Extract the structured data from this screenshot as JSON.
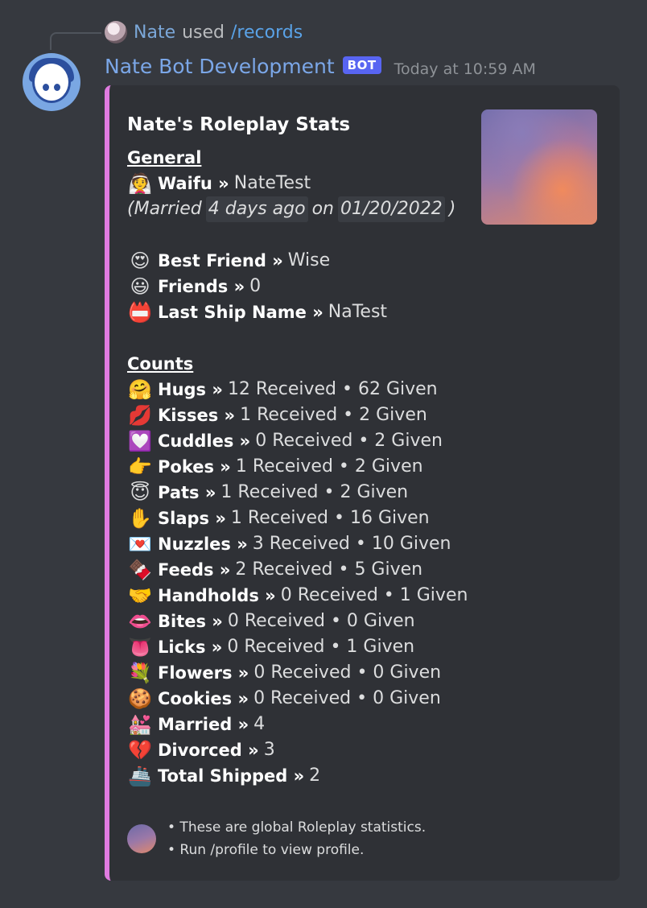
{
  "reply": {
    "user": "Nate",
    "verb": "used",
    "command": "/records"
  },
  "message": {
    "author": "Nate Bot Development",
    "tag": "BOT",
    "timestamp": "Today at 10:59 AM"
  },
  "embed": {
    "title": "Nate's Roleplay Stats",
    "accent_color": "#e07be0",
    "general": {
      "heading": "General",
      "waifu": {
        "icon": "👰",
        "icon_name": "bride-icon",
        "label": "Waifu »",
        "value": "NateTest"
      },
      "married": {
        "prefix": "(Married",
        "ago": "4 days ago",
        "on": "on",
        "date": "01/20/2022",
        "suffix": ")"
      },
      "best_friend": {
        "icon": "😍",
        "icon_name": "heart-eyes-icon",
        "label": "Best Friend »",
        "value": "Wise"
      },
      "friends": {
        "icon": "😃",
        "icon_name": "smiley-icon",
        "label": "Friends »",
        "value": "0"
      },
      "last_ship": {
        "icon": "📛",
        "icon_name": "name-badge-icon",
        "label": "Last Ship Name »",
        "value": "NaTest"
      }
    },
    "counts_heading": "Counts",
    "counts": [
      {
        "icon": "🤗",
        "icon_name": "hugging-icon",
        "label": "Hugs »",
        "value": "12 Received • 62 Given"
      },
      {
        "icon": "💋",
        "icon_name": "kiss-mark-icon",
        "label": "Kisses »",
        "value": "1 Received • 2 Given"
      },
      {
        "icon": "💟",
        "icon_name": "heart-decoration-icon",
        "label": "Cuddles »",
        "value": "0 Received • 2 Given"
      },
      {
        "icon": "👉",
        "icon_name": "pointing-finger-icon",
        "label": "Pokes »",
        "value": "1 Received • 2 Given"
      },
      {
        "icon": "😇",
        "icon_name": "halo-face-icon",
        "label": "Pats »",
        "value": "1 Received • 2 Given"
      },
      {
        "icon": "✋",
        "icon_name": "raised-hand-icon",
        "label": "Slaps »",
        "value": "1 Received • 16 Given"
      },
      {
        "icon": "💌",
        "icon_name": "love-letter-icon",
        "label": "Nuzzles »",
        "value": "3 Received • 10 Given"
      },
      {
        "icon": "🍫",
        "icon_name": "chocolate-bar-icon",
        "label": "Feeds »",
        "value": "2 Received • 5 Given"
      },
      {
        "icon": "🤝",
        "icon_name": "handshake-icon",
        "label": "Handholds »",
        "value": "0 Received • 1 Given"
      },
      {
        "icon": "👄",
        "icon_name": "mouth-icon",
        "label": "Bites »",
        "value": "0 Received • 0 Given"
      },
      {
        "icon": "👅",
        "icon_name": "tongue-icon",
        "label": "Licks »",
        "value": "0 Received • 1 Given"
      },
      {
        "icon": "💐",
        "icon_name": "bouquet-icon",
        "label": "Flowers »",
        "value": "0 Received • 0 Given"
      },
      {
        "icon": "🍪",
        "icon_name": "cookie-icon",
        "label": "Cookies »",
        "value": "0 Received • 0 Given"
      },
      {
        "icon": "💒",
        "icon_name": "wedding-icon",
        "label": "Married »",
        "value": "4"
      },
      {
        "icon": "💔",
        "icon_name": "broken-heart-icon",
        "label": "Divorced »",
        "value": "3"
      },
      {
        "icon": "🚢",
        "icon_name": "ship-icon",
        "label": "Total Shipped »",
        "value": "2"
      }
    ],
    "footer": {
      "line1": "• These are global Roleplay statistics.",
      "line2": "• Run /profile to view profile."
    }
  }
}
